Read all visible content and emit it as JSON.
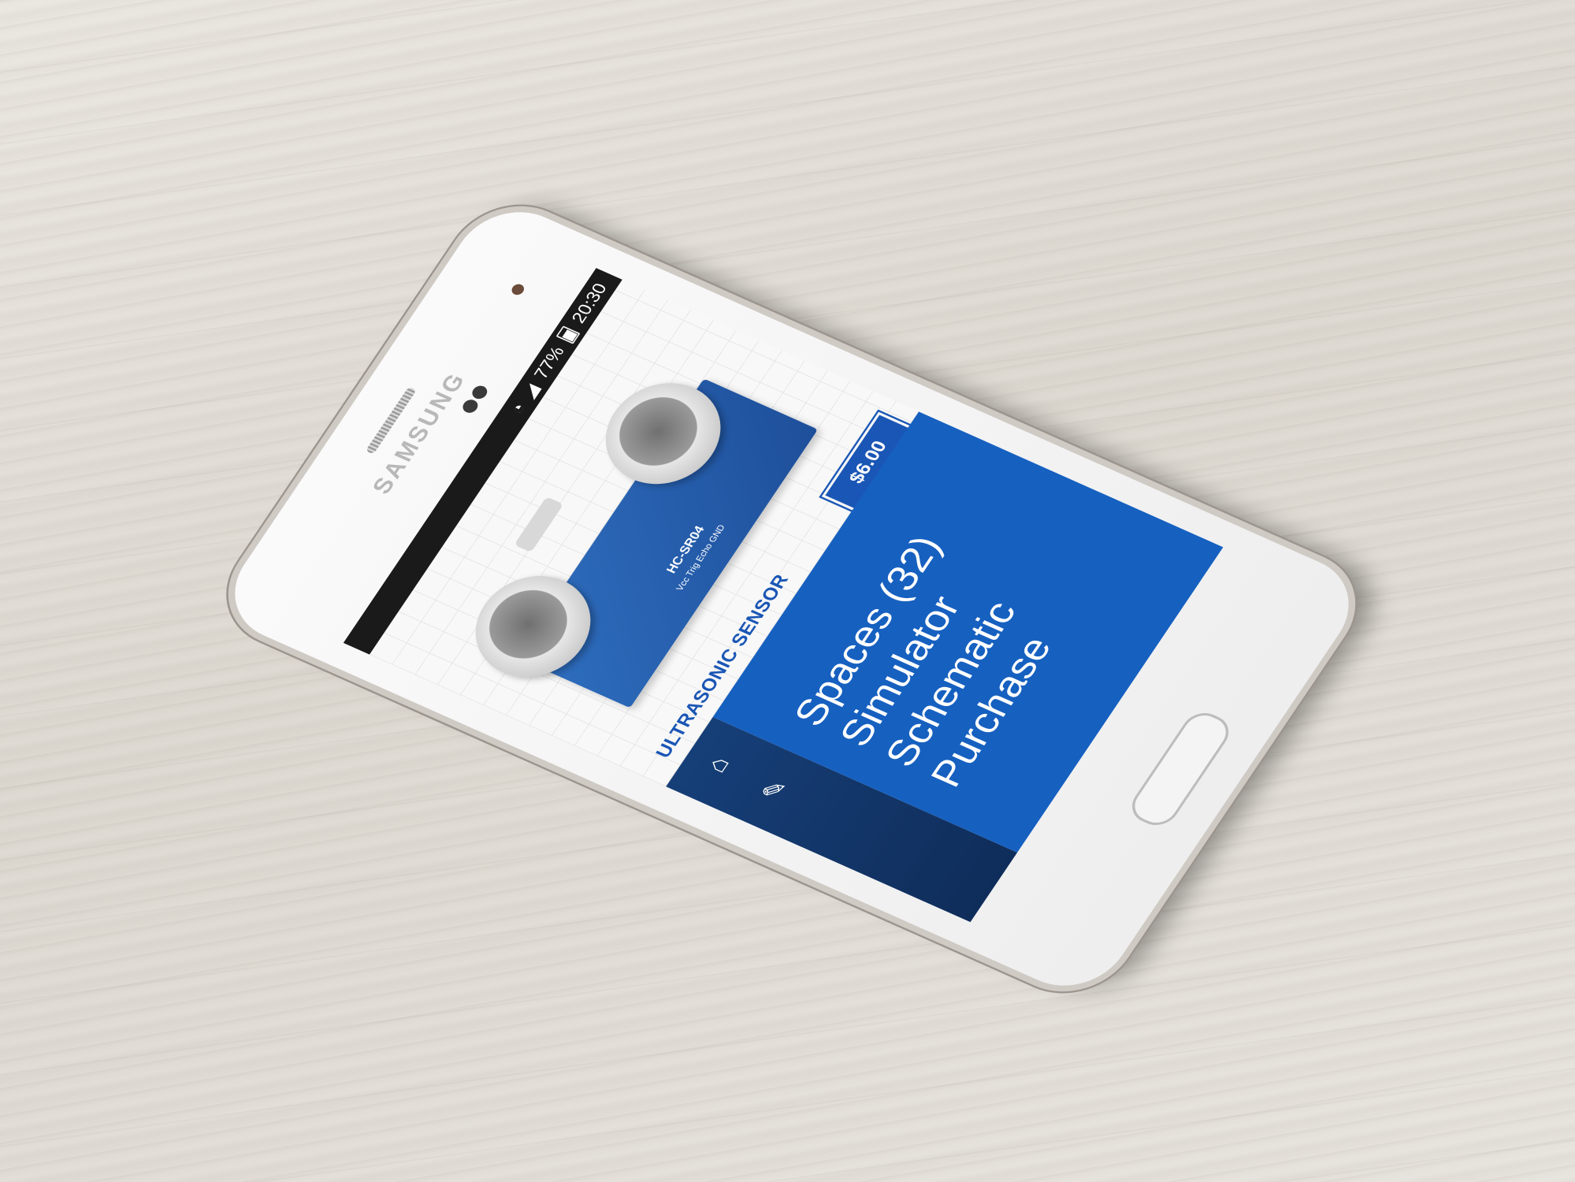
{
  "device": {
    "brand": "SAMSUNG"
  },
  "status_bar": {
    "battery": "77%",
    "time": "20:30",
    "wifi_icon": "wifi-icon",
    "signal_icon": "signal-icon",
    "battery_icon": "battery-icon"
  },
  "product": {
    "title": "ULTRASONIC SENSOR",
    "price": "$6.00",
    "board_model": "HC-SR04",
    "pin_labels": "Vcc Trig Echo GND"
  },
  "side_nav": {
    "items": [
      {
        "icon": "home-icon",
        "glyph": "⌂"
      },
      {
        "icon": "edit-icon",
        "glyph": "✎"
      }
    ]
  },
  "menu": {
    "items": [
      {
        "label": "Spaces (32)"
      },
      {
        "label": "Simulator"
      },
      {
        "label": "Schematic"
      },
      {
        "label": "Purchase"
      }
    ]
  },
  "colors": {
    "accent": "#1660c0",
    "nav_dark": "#163f78",
    "title_blue": "#1a56b5"
  }
}
